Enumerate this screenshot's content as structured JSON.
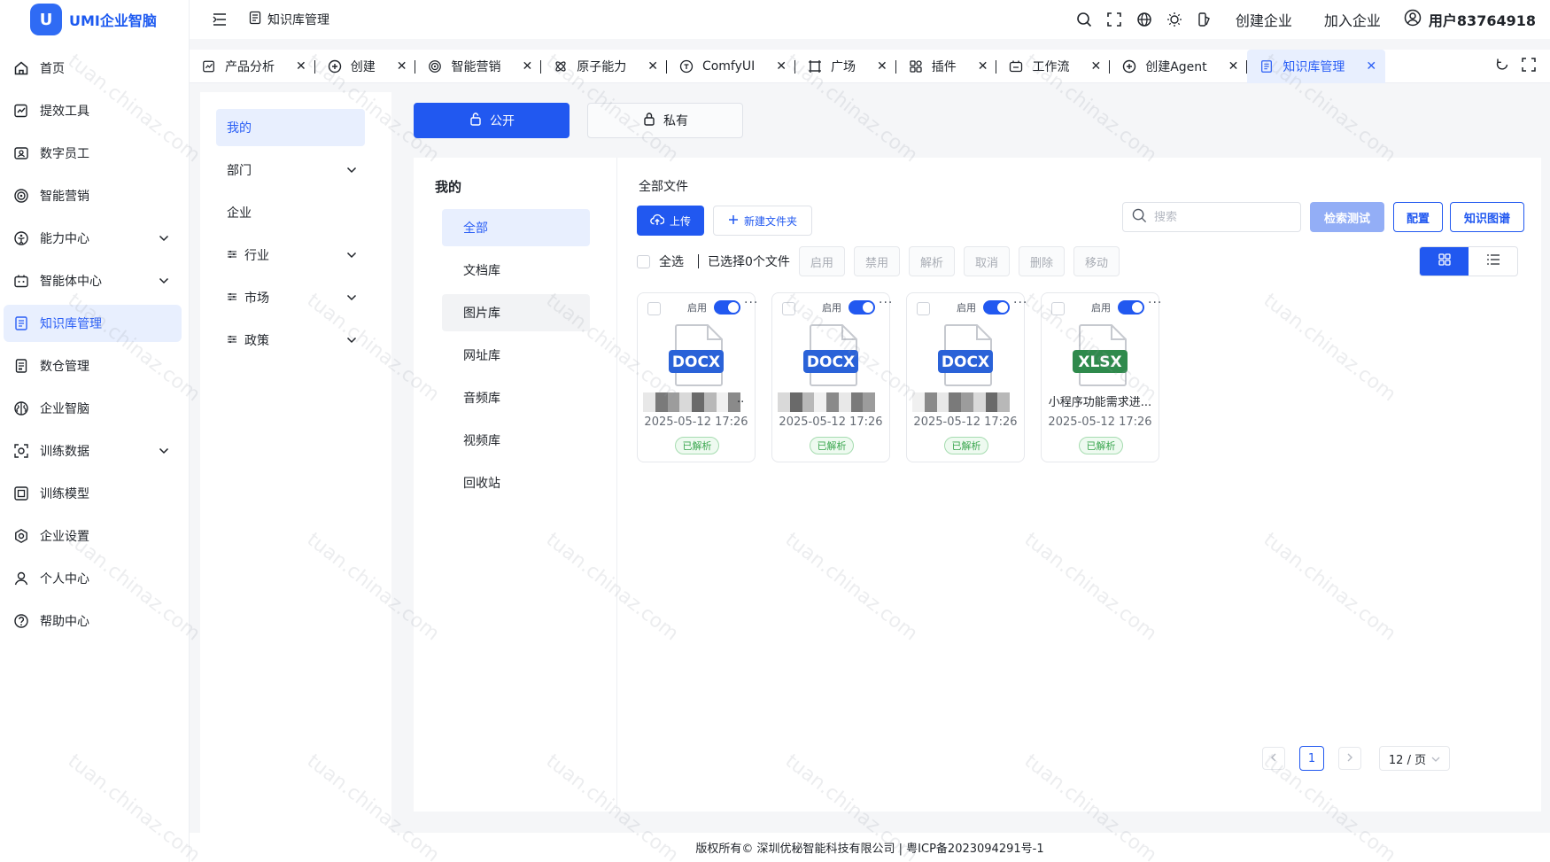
{
  "app": {
    "name": "UMI企业智脑",
    "logo_mark": "U"
  },
  "header": {
    "page_title": "知识库管理",
    "links": {
      "create_company": "创建企业",
      "join_company": "加入企业"
    },
    "user_name": "用户83764918"
  },
  "nav": {
    "items": [
      {
        "label": "首页",
        "icon": "home-icon"
      },
      {
        "label": "提效工具",
        "icon": "chart-edit-icon"
      },
      {
        "label": "数字员工",
        "icon": "digital-worker-icon"
      },
      {
        "label": "智能营销",
        "icon": "target-icon"
      },
      {
        "label": "能力中心",
        "icon": "ability-icon",
        "expandable": true
      },
      {
        "label": "智能体中心",
        "icon": "agent-icon",
        "expandable": true
      },
      {
        "label": "知识库管理",
        "icon": "book-icon",
        "active": true
      },
      {
        "label": "数仓管理",
        "icon": "database-icon"
      },
      {
        "label": "企业智脑",
        "icon": "brain-icon"
      },
      {
        "label": "训练数据",
        "icon": "training-data-icon",
        "expandable": true
      },
      {
        "label": "训练模型",
        "icon": "model-icon"
      },
      {
        "label": "企业设置",
        "icon": "settings-icon"
      },
      {
        "label": "个人中心",
        "icon": "user-icon"
      },
      {
        "label": "帮助中心",
        "icon": "help-icon"
      }
    ]
  },
  "tabs": [
    {
      "label": "产品分析",
      "icon": "chart-edit-icon"
    },
    {
      "label": "创建",
      "icon": "plus-circle-icon"
    },
    {
      "label": "智能营销",
      "icon": "target-icon"
    },
    {
      "label": "原子能力",
      "icon": "atom-icon"
    },
    {
      "label": "ComfyUI",
      "icon": "comfy-icon"
    },
    {
      "label": "广场",
      "icon": "square-icon"
    },
    {
      "label": "插件",
      "icon": "plugin-icon"
    },
    {
      "label": "工作流",
      "icon": "workflow-icon"
    },
    {
      "label": "创建Agent",
      "icon": "plus-circle-icon"
    },
    {
      "label": "知识库管理",
      "icon": "book-icon",
      "active": true
    }
  ],
  "categories": [
    {
      "label": "我的",
      "active": true
    },
    {
      "label": "部门",
      "expandable": true
    },
    {
      "label": "企业"
    },
    {
      "label": "行业",
      "expandable": true,
      "filter_icon": true
    },
    {
      "label": "市场",
      "expandable": true,
      "filter_icon": true
    },
    {
      "label": "政策",
      "expandable": true,
      "filter_icon": true
    }
  ],
  "visibility": {
    "public_label": "公开",
    "private_label": "私有"
  },
  "library": {
    "title": "我的",
    "items": [
      {
        "label": "全部",
        "active": true
      },
      {
        "label": "文档库"
      },
      {
        "label": "图片库",
        "hover": true
      },
      {
        "label": "网址库"
      },
      {
        "label": "音频库"
      },
      {
        "label": "视频库"
      },
      {
        "label": "回收站"
      }
    ]
  },
  "files": {
    "title": "全部文件",
    "upload_label": "上传",
    "new_folder_label": "新建文件夹",
    "search_placeholder": "搜索",
    "test_label": "检索测试",
    "config_label": "配置",
    "graph_label": "知识图谱",
    "select_all_label": "全选",
    "selected_count_text": "已选择0个文件",
    "bulk_actions": [
      "启用",
      "禁用",
      "解析",
      "取消",
      "删除",
      "移动"
    ],
    "items": [
      {
        "type": "DOCX",
        "name": "..",
        "blurred": true,
        "status": "启用",
        "enabled": true,
        "date": "2025-05-12 17:26",
        "badge": "已解析"
      },
      {
        "type": "DOCX",
        "name": "",
        "blurred": true,
        "status": "启用",
        "enabled": true,
        "date": "2025-05-12 17:26",
        "badge": "已解析"
      },
      {
        "type": "DOCX",
        "name": "",
        "blurred": true,
        "status": "启用",
        "enabled": true,
        "date": "2025-05-12 17:26",
        "badge": "已解析"
      },
      {
        "type": "XLSX",
        "name": "小程序功能需求进...",
        "blurred": false,
        "status": "启用",
        "enabled": true,
        "date": "2025-05-12 17:26",
        "badge": "已解析"
      }
    ]
  },
  "pagination": {
    "current": "1",
    "page_size": "12 / 页"
  },
  "footer": {
    "text": "版权所有© 深圳优秘智能科技有限公司 | 粤ICP备2023094291号-1"
  },
  "watermark_text": "tuan.chinaz.com",
  "colors": {
    "primary": "#2158f0",
    "docx": "#2a62d8",
    "xlsx": "#2f8a4c",
    "parsed": "#3aa64e"
  }
}
